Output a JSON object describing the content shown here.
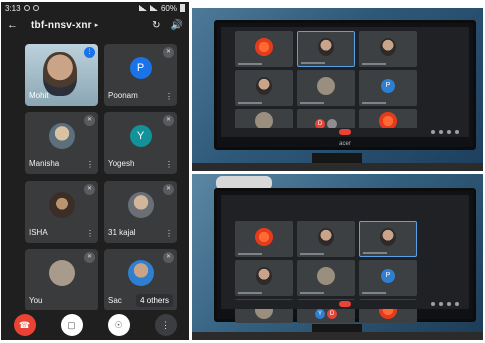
{
  "phone": {
    "status": {
      "time": "3:13",
      "battery": "60%"
    },
    "meeting_code": "tbf-nnsv-xnr",
    "tiles": [
      {
        "name": "Mohit"
      },
      {
        "name": "Poonam",
        "initial": "P",
        "color": "#1a73e8"
      },
      {
        "name": "Manisha"
      },
      {
        "name": "Yogesh",
        "initial": "Y",
        "color": "#12939a"
      },
      {
        "name": "ISHA"
      },
      {
        "name": "31 kajal"
      },
      {
        "name": "You"
      },
      {
        "name": "Sac"
      }
    ],
    "others_label": "4 others"
  },
  "monitor": {
    "brand": "acer",
    "avatars": {
      "p": "P",
      "d": "D",
      "y": "Y"
    }
  },
  "colors": {
    "meet_bg": "#202124",
    "end_call": "#ea4335",
    "accent": "#1a73e8"
  }
}
